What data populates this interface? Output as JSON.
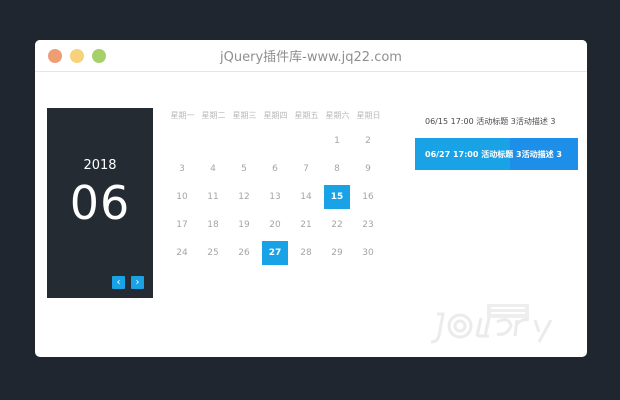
{
  "window": {
    "title": "jQuery插件库-www.jq22.com"
  },
  "panel": {
    "year": "2018",
    "month": "06",
    "prev": "‹",
    "next": "›"
  },
  "calendar": {
    "weekdays": [
      "星期一",
      "星期二",
      "星期三",
      "星期四",
      "星期五",
      "星期六",
      "星期日"
    ],
    "rows": [
      [
        "",
        "",
        "",
        "",
        "",
        "1",
        "2"
      ],
      [
        "3",
        "4",
        "5",
        "6",
        "7",
        "8",
        "9"
      ],
      [
        "10",
        "11",
        "12",
        "13",
        "14",
        "15",
        "16"
      ],
      [
        "17",
        "18",
        "19",
        "20",
        "21",
        "22",
        "23"
      ],
      [
        "24",
        "25",
        "26",
        "27",
        "28",
        "29",
        "30"
      ]
    ],
    "selected_days": [
      "15",
      "27"
    ]
  },
  "events": [
    {
      "text": "06/15 17:00 活动标题 3活动描述 3",
      "active": false
    },
    {
      "text": "06/27 17:00 活动标题 3活动描述 3",
      "active": true
    }
  ],
  "colors": {
    "accent": "#1aa2e6",
    "panel": "#242b33",
    "background": "#1f2630"
  }
}
